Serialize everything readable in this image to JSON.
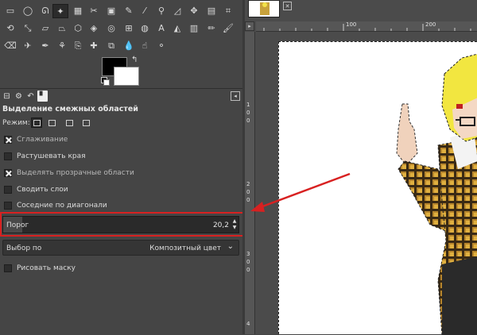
{
  "tool_options": {
    "title": "Выделение смежных областей",
    "mode_label": "Режим:",
    "options": [
      {
        "label": "Сглаживание",
        "checked": true
      },
      {
        "label": "Растушевать края",
        "checked": false
      },
      {
        "label": "Выделять прозрачные области",
        "checked": true
      },
      {
        "label": "Сводить слои",
        "checked": false
      },
      {
        "label": "Соседние по диагонали",
        "checked": false
      }
    ],
    "threshold": {
      "label": "Порог",
      "value": "20,2",
      "fraction": 0.08
    },
    "select_by": {
      "label": "Выбор по",
      "value": "Композитный цвет"
    },
    "draw_mask": {
      "label": "Рисовать маску",
      "checked": false
    }
  },
  "rulers": {
    "horizontal": [
      "100",
      "200"
    ],
    "vertical": [
      "1",
      "0",
      "0",
      "2",
      "0",
      "0",
      "3",
      "0",
      "0",
      "4"
    ]
  },
  "colors": {
    "annotation": "#d82121",
    "fg": "#000000",
    "bg": "#ffffff"
  }
}
